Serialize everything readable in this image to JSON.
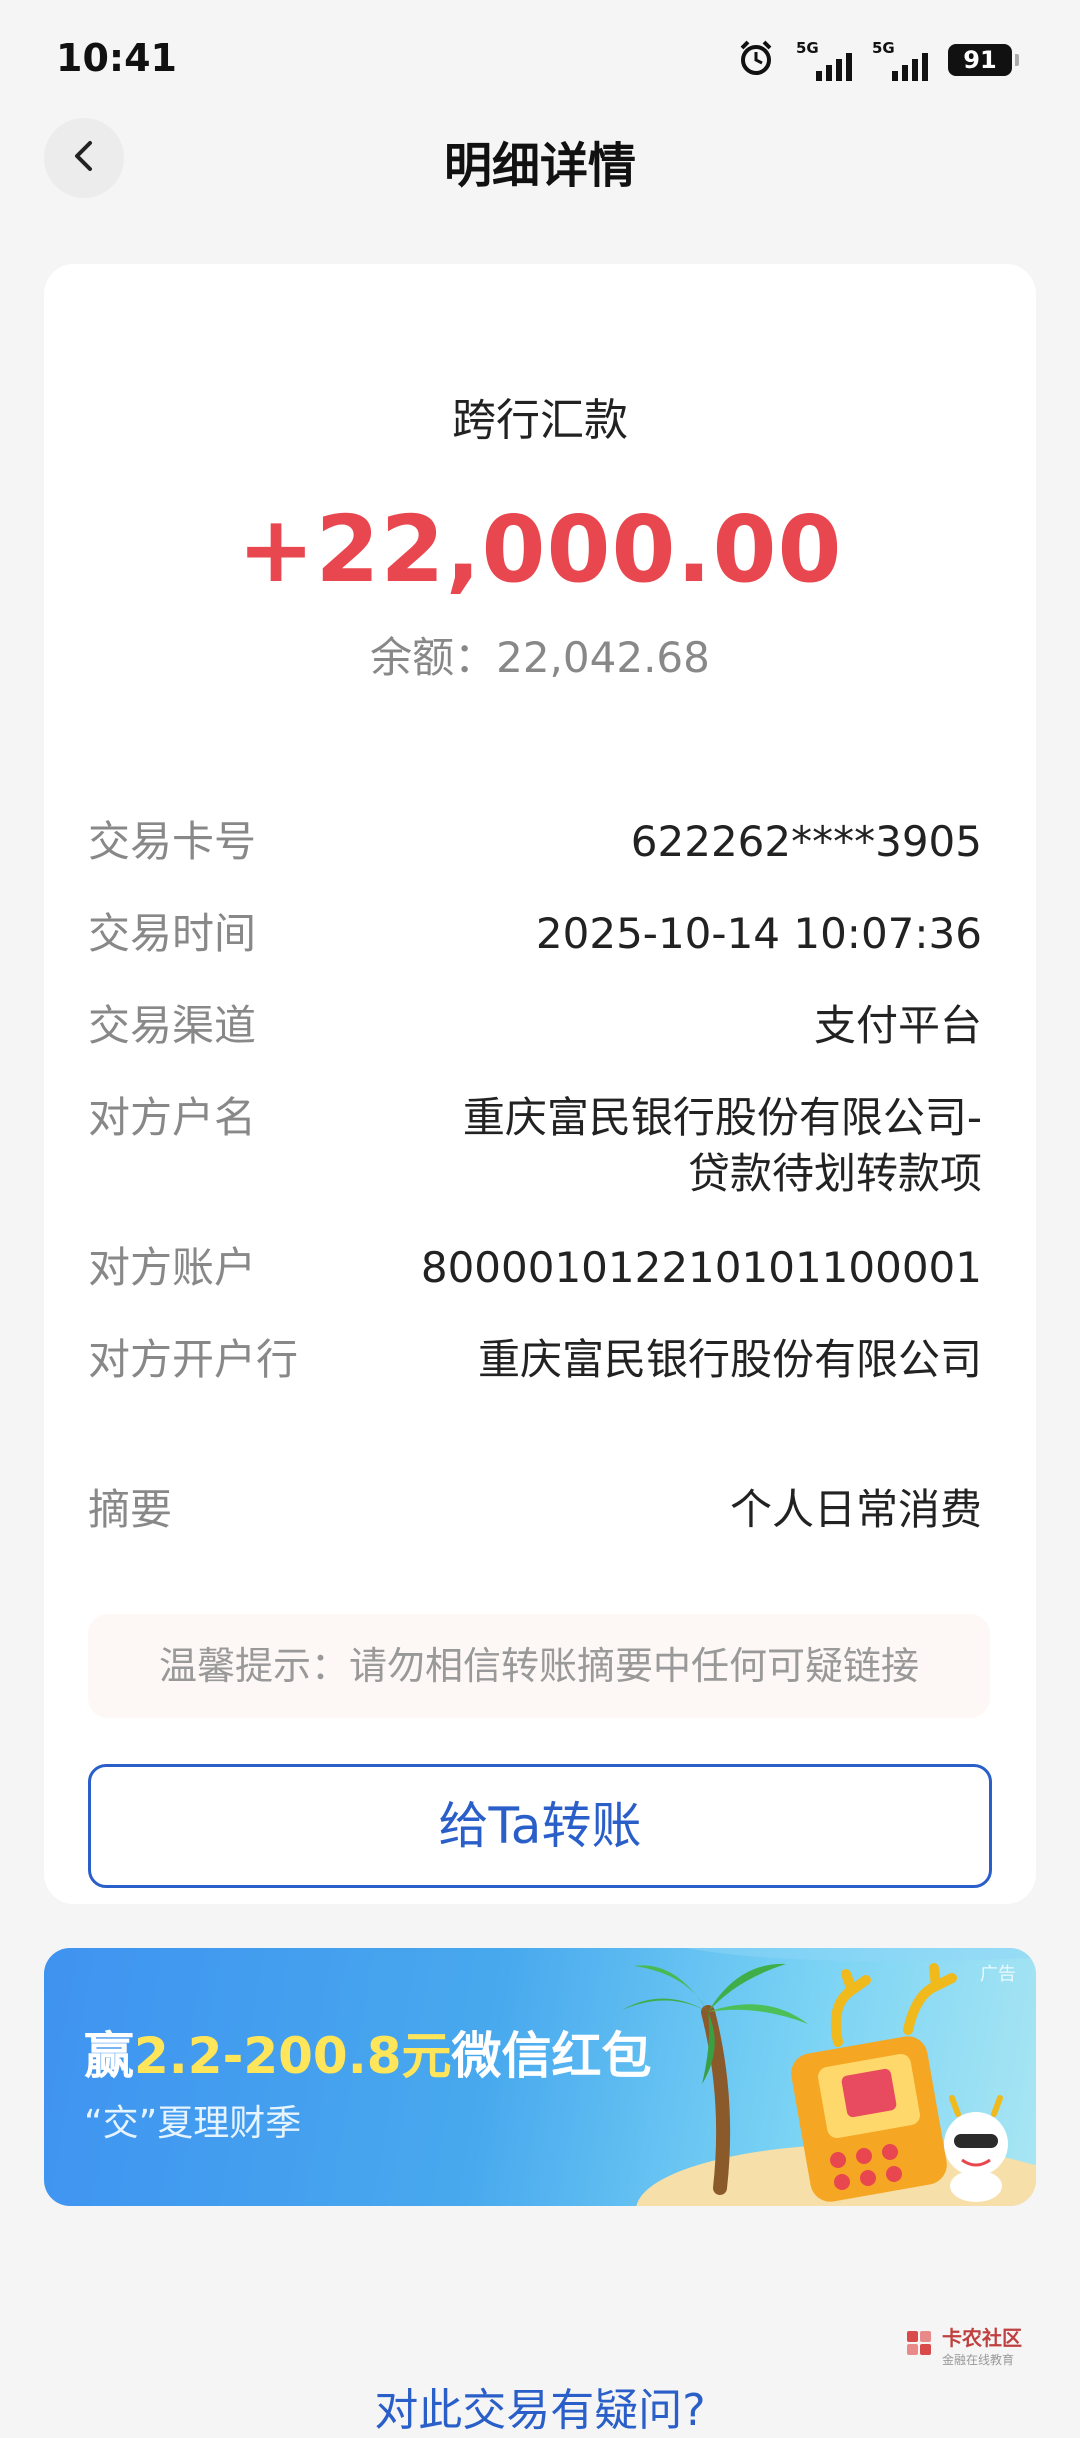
{
  "status": {
    "time": "10:41",
    "net1": "5G",
    "net2": "5G",
    "battery": "91"
  },
  "header": {
    "title": "明细详情"
  },
  "transaction": {
    "type": "跨行汇款",
    "amount": "+22,000.00",
    "balance": "余额：22,042.68"
  },
  "details": [
    {
      "label": "交易卡号",
      "value": "622262****3905"
    },
    {
      "label": "交易时间",
      "value": "2025-10-14 10:07:36"
    },
    {
      "label": "交易渠道",
      "value": "支付平台"
    },
    {
      "label": "对方户名",
      "value": "重庆富民银行股份有限公司-贷款待划转款项"
    },
    {
      "label": "对方账户",
      "value": "800001012210101100001"
    },
    {
      "label": "对方开户行",
      "value": "重庆富民银行股份有限公司"
    },
    {
      "label": "摘要",
      "value": "个人日常消费"
    }
  ],
  "tip": "温馨提示：请勿相信转账摘要中任何可疑链接",
  "transfer_button": "给Ta转账",
  "banner": {
    "title_prefix": "赢",
    "title_highlight": "2.2-200.8元",
    "title_suffix": "微信红包",
    "subtitle": "“交”夏理财季",
    "ad_tag": "广告"
  },
  "watermark": {
    "name": "卡农社区",
    "sub": "金融在线教育"
  },
  "question_link": "对此交易有疑问?",
  "colors": {
    "amount": "#e8474f",
    "link": "#2a5fc9"
  }
}
